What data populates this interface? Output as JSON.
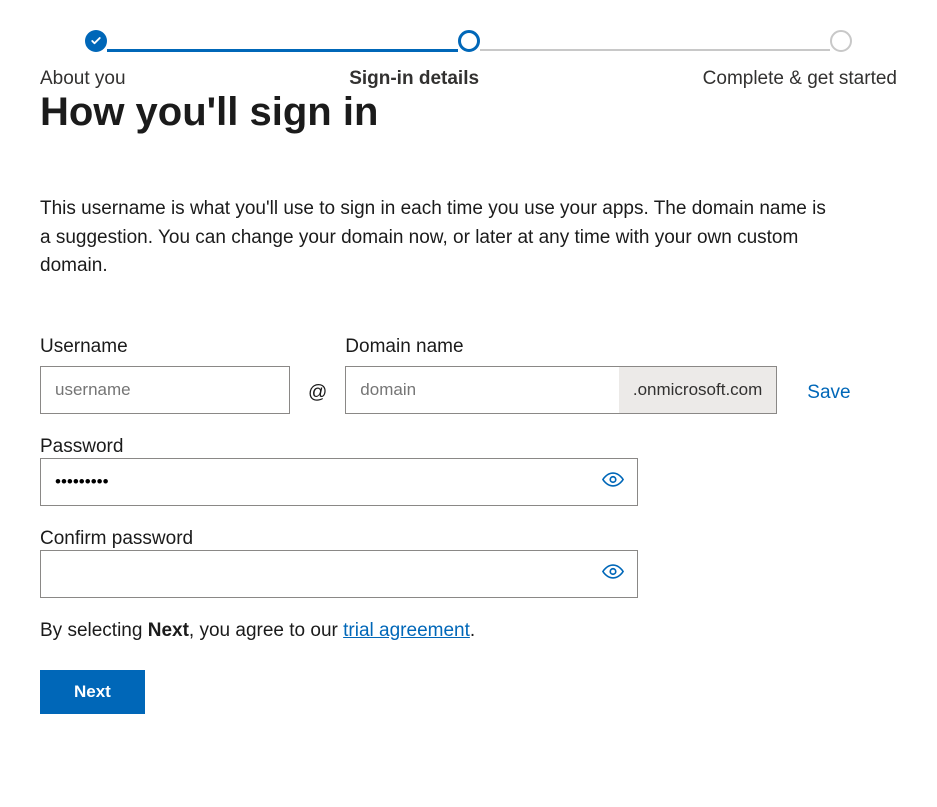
{
  "stepper": {
    "step1": {
      "label": "About you"
    },
    "step2": {
      "label": "Sign-in details"
    },
    "step3": {
      "label": "Complete & get started"
    }
  },
  "heading": "How you'll sign in",
  "description": "This username is what you'll use to sign in each time you use your apps. The domain name is a suggestion. You can change your domain now, or later at any time with your own custom domain.",
  "form": {
    "username_label": "Username",
    "username_placeholder": "username",
    "username_value": "",
    "at": "@",
    "domain_label": "Domain name",
    "domain_placeholder": "domain",
    "domain_value": "",
    "domain_suffix": ".onmicrosoft.com",
    "save_label": "Save",
    "password_label": "Password",
    "password_value": "•••••••••",
    "confirm_label": "Confirm password",
    "confirm_value": ""
  },
  "agreement": {
    "prefix": "By selecting ",
    "bold": "Next",
    "middle": ", you agree to our ",
    "link": "trial agreement",
    "suffix": "."
  },
  "next_label": "Next"
}
